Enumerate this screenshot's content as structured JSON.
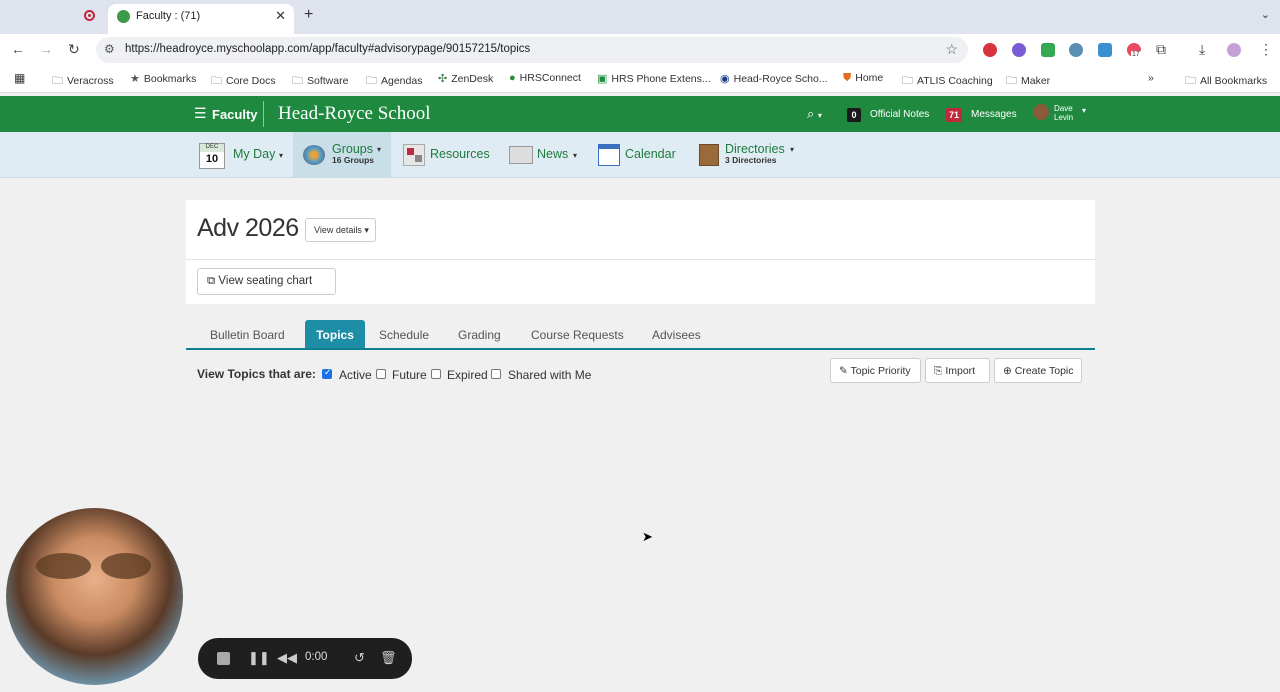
{
  "browser": {
    "tab_title": "Faculty : (71)",
    "url": "https://headroyce.myschoolapp.com/app/faculty#advisorypage/90157215/topics",
    "bookmarks": [
      "Veracross",
      "Bookmarks",
      "Core Docs",
      "Software",
      "Agendas",
      "ZenDesk",
      "HRSConnect",
      "HRS Phone Extens...",
      "Head-Royce Scho...",
      "Home",
      "ATLIS Coaching",
      "Maker"
    ],
    "all_bookmarks": "All Bookmarks",
    "ext_badge": "17"
  },
  "header": {
    "portal": "Faculty",
    "school": "Head-Royce School",
    "official_notes_count": "0",
    "official_notes": "Official Notes",
    "messages_count": "71",
    "messages": "Messages",
    "user_first": "Dave",
    "user_last": "Levin"
  },
  "subnav": {
    "cal_month": "DEC",
    "cal_day": "10",
    "my_day": "My Day",
    "groups": "Groups",
    "groups_sub": "16 Groups",
    "resources": "Resources",
    "news": "News",
    "calendar": "Calendar",
    "directories": "Directories",
    "directories_sub": "3 Directories"
  },
  "page": {
    "title": "Adv 2026",
    "view_details": "View details",
    "seating_chart": "View seating chart",
    "tabs": [
      "Bulletin Board",
      "Topics",
      "Schedule",
      "Grading",
      "Course Requests",
      "Advisees"
    ],
    "active_tab": "Topics",
    "filter_label": "View Topics that are:",
    "filters": [
      {
        "label": "Active",
        "checked": true
      },
      {
        "label": "Future",
        "checked": false
      },
      {
        "label": "Expired",
        "checked": false
      },
      {
        "label": "Shared with Me",
        "checked": false
      }
    ],
    "topic_priority": "Topic Priority",
    "import": "Import",
    "create_topic": "Create Topic"
  },
  "recorder": {
    "time": "0:00"
  }
}
